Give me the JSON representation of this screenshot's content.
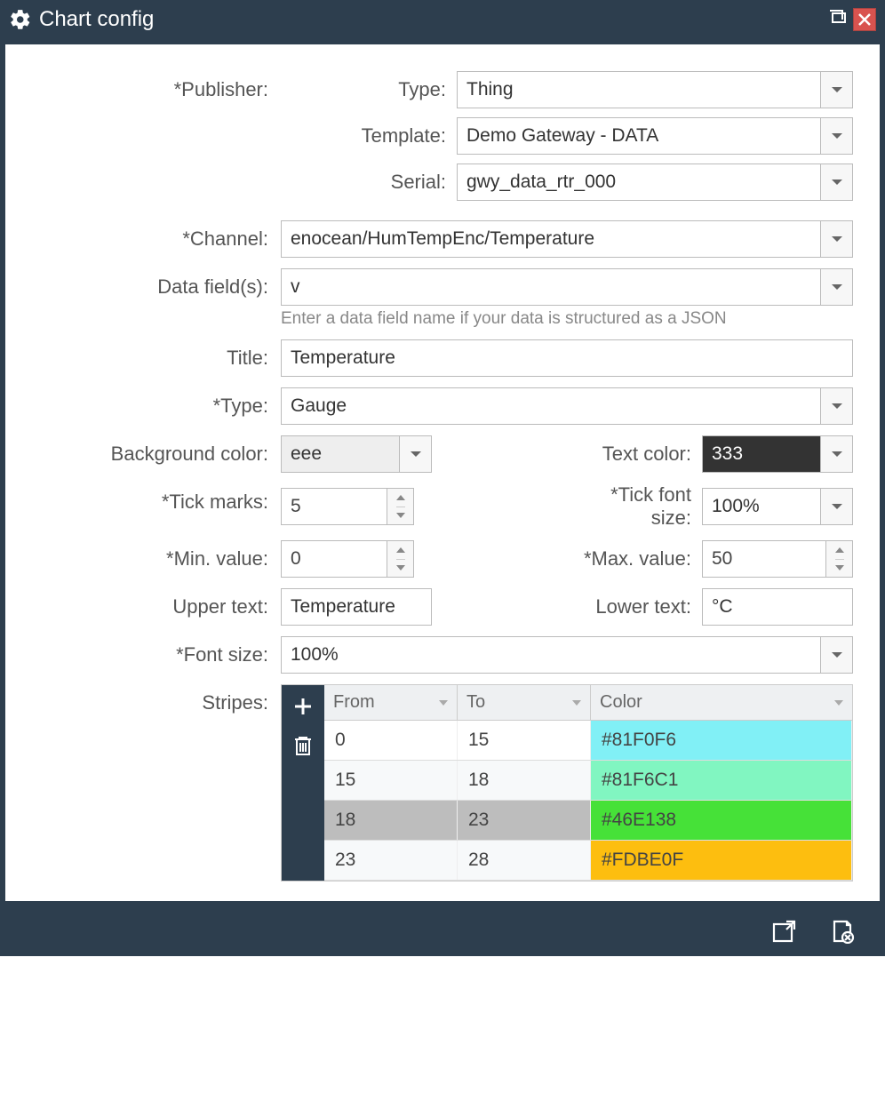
{
  "window": {
    "title": "Chart config"
  },
  "labels": {
    "publisher": "*Publisher:",
    "type": "Type:",
    "template": "Template:",
    "serial": "Serial:",
    "channel": "*Channel:",
    "data_fields": "Data field(s):",
    "data_fields_help": "Enter a data field name if your data is structured as a JSON",
    "title": "Title:",
    "chart_type": "*Type:",
    "bg_color": "Background color:",
    "text_color": "Text color:",
    "tick_marks": "*Tick marks:",
    "tick_font_size": "*Tick font size:",
    "min_value": "*Min. value:",
    "max_value": "*Max. value:",
    "upper_text": "Upper text:",
    "lower_text": "Lower text:",
    "font_size": "*Font size:",
    "stripes": "Stripes:"
  },
  "values": {
    "pub_type": "Thing",
    "pub_template": "Demo Gateway - DATA",
    "pub_serial": "gwy_data_rtr_000",
    "channel": "enocean/HumTempEnc/Temperature",
    "data_fields": "v",
    "title": "Temperature",
    "chart_type": "Gauge",
    "bg_color": "eee",
    "text_color": "333",
    "tick_marks": "5",
    "tick_font_size": "100%",
    "min_value": "0",
    "max_value": "50",
    "upper_text": "Temperature",
    "lower_text": "°C",
    "font_size": "100%"
  },
  "stripes": {
    "headers": {
      "from": "From",
      "to": "To",
      "color": "Color"
    },
    "rows": [
      {
        "from": "0",
        "to": "15",
        "color": "#81F0F6"
      },
      {
        "from": "15",
        "to": "18",
        "color": "#81F6C1"
      },
      {
        "from": "18",
        "to": "23",
        "color": "#46E138"
      },
      {
        "from": "23",
        "to": "28",
        "color": "#FDBE0F"
      }
    ],
    "selected_index": 2
  }
}
